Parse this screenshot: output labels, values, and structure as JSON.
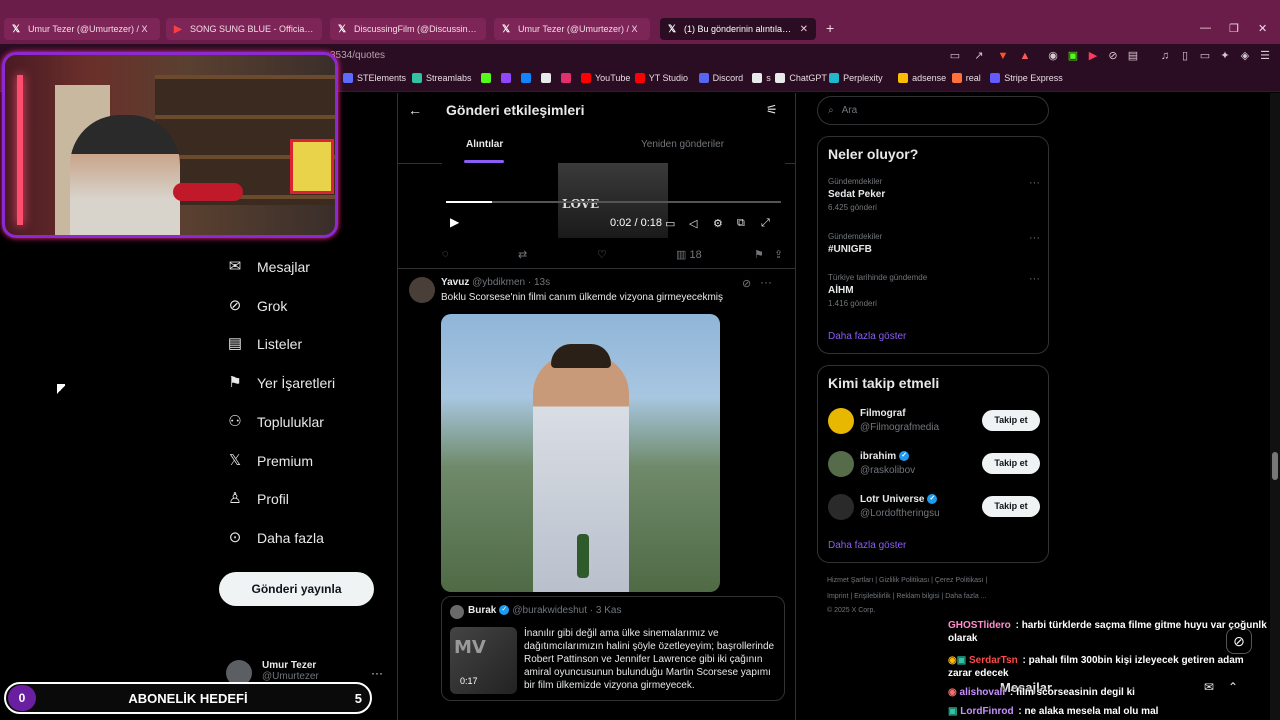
{
  "browser": {
    "tabs": [
      {
        "label": "Umur Tezer (@Umurtezer) / X",
        "icon": "x-icon"
      },
      {
        "label": "SONG SUNG BLUE - Official Trailer 2",
        "icon": "youtube-icon"
      },
      {
        "label": "DiscussingFilm (@DiscussingFilm) / X",
        "icon": "x-icon"
      },
      {
        "label": "Umur Tezer (@Umurtezer) / X",
        "icon": "x-icon"
      },
      {
        "label": "(1) Bu gönderinin alıntılamala",
        "icon": "x-icon"
      }
    ],
    "url": "3534/quotes",
    "bookmarks": [
      {
        "label": "STElements",
        "color": "#5b6cff"
      },
      {
        "label": "Streamlabs",
        "color": "#31c3a2"
      },
      {
        "label": "",
        "color": "#53fc18"
      },
      {
        "label": "",
        "color": "#9146ff"
      },
      {
        "label": "",
        "color": "#1185fe"
      },
      {
        "label": "",
        "color": "#e7e9ea"
      },
      {
        "label": "",
        "color": "#e1306c"
      },
      {
        "label": "YouTube",
        "color": "#ff0000"
      },
      {
        "label": "YT Studio",
        "color": "#ff0000"
      },
      {
        "label": "Discord",
        "color": "#5865f2"
      },
      {
        "label": "s",
        "color": "#e7e9ea"
      },
      {
        "label": "ChatGPT",
        "color": "#e7e9ea"
      },
      {
        "label": "Perplexity",
        "color": "#20b8cd"
      },
      {
        "label": "adsense",
        "color": "#fbbc04"
      },
      {
        "label": "real",
        "color": "#ff7139"
      },
      {
        "label": "Stripe Express",
        "color": "#635bff"
      }
    ]
  },
  "nav": {
    "items": [
      {
        "label": "Mesajlar",
        "icon": "mail-icon"
      },
      {
        "label": "Grok",
        "icon": "grok-icon"
      },
      {
        "label": "Listeler",
        "icon": "list-icon"
      },
      {
        "label": "Yer İşaretleri",
        "icon": "bookmark-icon"
      },
      {
        "label": "Topluluklar",
        "icon": "people-icon"
      },
      {
        "label": "Premium",
        "icon": "x-icon"
      },
      {
        "label": "Profil",
        "icon": "profile-icon"
      },
      {
        "label": "Daha fazla",
        "icon": "more-circle-icon"
      }
    ],
    "post_button": "Gönderi yayınla",
    "profile": {
      "name": "Umur Tezer",
      "handle": "@Umurtezer"
    }
  },
  "center": {
    "title": "Gönderi etkileşimleri",
    "tabs": [
      "Alıntılar",
      "Yeniden gönderiler"
    ],
    "video": {
      "time": "0:02 / 0:18",
      "thumb_text": "LOVE"
    },
    "actions": {
      "views": "18"
    },
    "tweet": {
      "name": "Yavuz",
      "handle": "@ybdikmen",
      "time": "· 13s",
      "text": "Boklu Scorsese'nin filmi canım ülkemde vizyona girmeyecekmiş",
      "quote": {
        "name": "Burak",
        "handle": "@burakwideshut",
        "time": "· 3 Kas",
        "duration": "0:17",
        "thumb_text": "MV",
        "text": "İnanılır gibi değil ama ülke sinemalarımız ve dağıtımcılarımızın halini şöyle özetleyeyim; başrollerinde Robert Pattinson ve Jennifer Lawrence gibi iki çağının amiral oyuncusunun bulunduğu Martin Scorsese yapımı bir film ülkemizde vizyona girmeyecek."
      }
    }
  },
  "right": {
    "search_placeholder": "Ara",
    "trends_title": "Neler oluyor?",
    "trends": [
      {
        "category": "Gündemdekiler",
        "title": "Sedat Peker",
        "count": "6.425 gönderi"
      },
      {
        "category": "Gündemdekiler",
        "title": "#UNIGFB",
        "count": ""
      },
      {
        "category": "Türkiye tarihinde gündemde",
        "title": "AİHM",
        "count": "1.416 gönderi"
      }
    ],
    "show_more": "Daha fazla göster",
    "who_title": "Kimi takip etmeli",
    "who": [
      {
        "name": "Filmograf",
        "handle": "@Filmografmedia",
        "verified": false
      },
      {
        "name": "ibrahim",
        "handle": "@raskolibov",
        "verified": true
      },
      {
        "name": "Lotr Universe",
        "handle": "@Lordoftheringsu",
        "verified": true
      }
    ],
    "follow_label": "Takip et",
    "footer": {
      "line1": "Hizmet Şartları  |  Gizlilik Politikası  |  Çerez Politikası  |",
      "line2": "Imprint  |  Erişilebilirlik  |  Reklam bilgisi  |  Daha fazla ...",
      "line3": "© 2025 X Corp."
    }
  },
  "overlay": {
    "goal": {
      "current": "0",
      "label": "ABONELİK HEDEFİ",
      "target": "5"
    },
    "dm_title": "Mesajlar",
    "chat": [
      {
        "user": "GHOSTlidero",
        "color": "#ff8fd0",
        "text": "harbi türklerde saçma filme gitme huyu var çoğunlk olarak"
      },
      {
        "user": "SerdarTsn",
        "color": "#ff4a4a",
        "text": "pahalı film 300bin kişi izleyecek getiren adam zarar edecek"
      },
      {
        "user": "alishovali",
        "color": "#c890ff",
        "text": "film scorseasinin degil ki"
      },
      {
        "user": "LordFinrod",
        "color": "#c890ff",
        "text": "ne alaka mesela mal olu mal"
      }
    ]
  }
}
